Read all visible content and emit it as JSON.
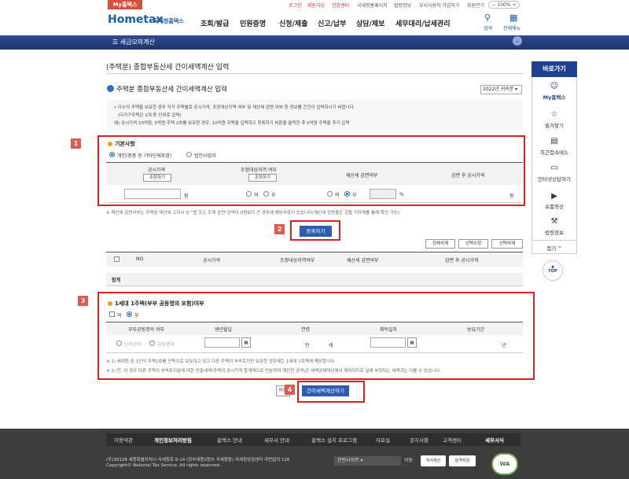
{
  "util": {
    "my_hometax": "My홈택스",
    "links": [
      "로그인",
      "회원가입",
      "인증센터",
      "국세청홈페이지",
      "법령정보",
      "부서사용자 가입하기",
      "회원연기"
    ],
    "zoom": "100%"
  },
  "header": {
    "logo": "Hometax",
    "logo_sub": "국세청홈택스",
    "nav": [
      "조회/발급",
      "민원증명",
      "신청/제출",
      "신고/납부",
      "상담/제보",
      "세무대리/납세관리"
    ],
    "search_label": "검색",
    "allmenu_label": "전체메뉴"
  },
  "bluebar": {
    "menu": "세금모의계산"
  },
  "page": {
    "title": "(주택분) 종합부동산세 간이세액계산 입력",
    "section_title": "주택분 종합부동산세 간이세액계산 입력",
    "year_select": "2022년 귀속분",
    "info": [
      "• 다수의 주택을 보유한 경우 각각 주택별로 공시가격, 조정대상지역 여부 및 재산세 감면 여부 등 정보를 건건이 입력하시기 바랍니다.",
      "(다가구주택은 1개 동 단위로 입력)",
      "예) 공시가격 10억원, 5억원 주택 2호를 보유한 경우, 10억원 주택을 입력하고 등록하기 버튼을 클릭한 후 5억원 주택을 추가 입력"
    ]
  },
  "section1": {
    "num": "1",
    "title": "기본사항",
    "radio_individual": "개인(종중 등 기타단체포함)",
    "radio_corp": "법인사업자",
    "col_price": "공시가격",
    "col_adjust": "조정대상지역 여부",
    "col_reduce": "재산세 감면여부",
    "col_after": "감면 후 공시가격",
    "lookup": "조회하기",
    "won": "원",
    "yes": "여",
    "no": "부",
    "percent": "%"
  },
  "note1": "※ 재산세 감면여부는 주택분 재산세 고지서 상 \"법 또는 조례 감면\"금액이 0원보다 큰 경우에 해당사항이 있습니다(재산세 감면율은 관할 지자체를 통해 확인 가능).",
  "section2": {
    "num": "2",
    "register": "등록하기",
    "btn_delete_all": "전체삭제",
    "btn_edit": "선택수정",
    "btn_delete_sel": "선택삭제",
    "cols": [
      "NO",
      "공시가격",
      "조정대상지역여부",
      "재산세 감면여부",
      "감면 후 공시가격"
    ],
    "total": "합계"
  },
  "section3": {
    "num": "3",
    "title": "1세대 1주택(부부 공동명의 포함)여부",
    "yes": "여",
    "no": "부",
    "cols": [
      "부부공동명의 여부",
      "생년월일",
      "연령",
      "취득일자",
      "보유기간"
    ],
    "single": "단독명의",
    "joint": "공동명의",
    "age_man": "만",
    "age_se": "세",
    "year": "년",
    "notes": [
      "※ 1) 세대원 중 1인이 주택1호를 단독으로 보유하고 있고 다른 주택의 부속토지만 보유한 경우에는 1세대 1주택에 해당합니다.",
      "※ 2) 단, 이 경우 다른 주택의 부속토지분에 대한 산출세액(주택의 공시가격 합계액으로 안분하여 계산한 금액)은 세액공제대상에서 제외되므로 실제 부과되는 세액과는 다를 수 있습니다."
    ]
  },
  "section4": {
    "num": "4",
    "prev": "이전",
    "calc": "간이세액계산하기"
  },
  "quick": {
    "head": "바로가기",
    "items": [
      "My홈택스",
      "즐겨찾기",
      "최근접속메뉴",
      "인터넷상담하기",
      "숏폼영상",
      "법령정보"
    ],
    "collapse": "접기 ^",
    "top": "TOP"
  },
  "footer": {
    "nav": [
      "이용약관",
      "개인정보처리방침",
      "홈택스 안내",
      "세무서 안내",
      "홈택스 설치 프로그램",
      "자료실",
      "공지사항",
      "고객센터",
      "세무서식"
    ],
    "addr1": "(우)30128 세종특별자치시 국세청로 8-14 (정부세종2청사 국세청동) 국세청상담센터 국번없이 126",
    "addr2": "Copyright© National Tax Service. All rights reserved.",
    "site_select": "관련사이트",
    "go": "이동",
    "badge1": "지식재산",
    "badge2": "원격지원",
    "wa": "WA"
  }
}
